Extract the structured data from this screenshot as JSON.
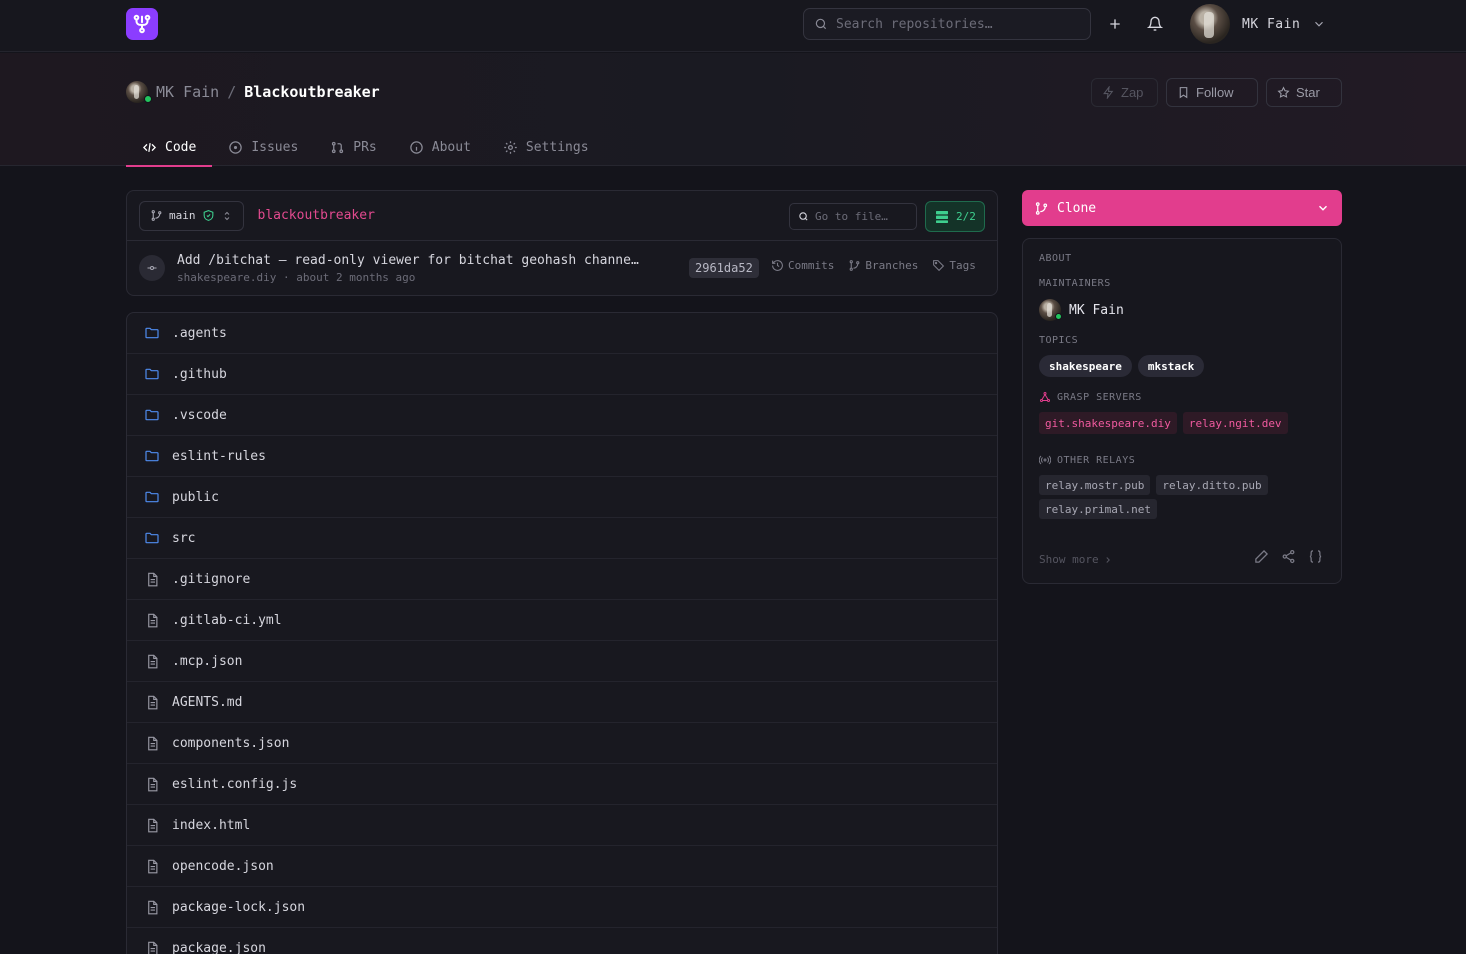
{
  "colors": {
    "accent": "#e23d8d",
    "logo": "#8b3dff",
    "online": "#22c55e",
    "relay_ok": "#3ecf8e"
  },
  "topbar": {
    "logo_icon": "fork-logo-icon",
    "search_placeholder": "Search repositories…",
    "add_icon": "plus-icon",
    "bell_icon": "bell-icon",
    "user_name": "MK Fain",
    "user_menu_icon": "chevron-down-icon"
  },
  "repo": {
    "owner": "MK Fain",
    "separator": "/",
    "name": "Blackoutbreaker",
    "actions": {
      "zap": "Zap",
      "follow": "Follow",
      "star": "Star"
    }
  },
  "tabs": [
    {
      "label": "Code",
      "icon": "code-icon",
      "active": true
    },
    {
      "label": "Issues",
      "icon": "circle-dot-icon",
      "active": false
    },
    {
      "label": "PRs",
      "icon": "pull-request-icon",
      "active": false
    },
    {
      "label": "About",
      "icon": "info-icon",
      "active": false
    },
    {
      "label": "Settings",
      "icon": "gear-icon",
      "active": false
    }
  ],
  "branch_bar": {
    "branch": "main",
    "repo_link": "blackoutbreaker",
    "goto_placeholder": "Go to file…",
    "relay_status": "2/2"
  },
  "commit": {
    "message": "Add /bitchat — read-only viewer for bitchat geohash channe…",
    "author": "shakespeare.diy",
    "dot": "·",
    "time": "about 2 months ago",
    "sha": "2961da52",
    "links": {
      "commits": "Commits",
      "branches": "Branches",
      "tags": "Tags"
    }
  },
  "files": [
    {
      "name": ".agents",
      "type": "folder"
    },
    {
      "name": ".github",
      "type": "folder"
    },
    {
      "name": ".vscode",
      "type": "folder"
    },
    {
      "name": "eslint-rules",
      "type": "folder"
    },
    {
      "name": "public",
      "type": "folder"
    },
    {
      "name": "src",
      "type": "folder"
    },
    {
      "name": ".gitignore",
      "type": "file"
    },
    {
      "name": ".gitlab-ci.yml",
      "type": "file"
    },
    {
      "name": ".mcp.json",
      "type": "file"
    },
    {
      "name": "AGENTS.md",
      "type": "file"
    },
    {
      "name": "components.json",
      "type": "file"
    },
    {
      "name": "eslint.config.js",
      "type": "file"
    },
    {
      "name": "index.html",
      "type": "file"
    },
    {
      "name": "opencode.json",
      "type": "file"
    },
    {
      "name": "package-lock.json",
      "type": "file"
    },
    {
      "name": "package.json",
      "type": "file"
    }
  ],
  "sidebar": {
    "clone_label": "Clone",
    "about_label": "ABOUT",
    "maintainers_label": "MAINTAINERS",
    "maintainer": "MK Fain",
    "topics_label": "TOPICS",
    "topics": [
      "shakespeare",
      "mkstack"
    ],
    "grasp_label": "GRASP SERVERS",
    "grasp_servers": [
      "git.shakespeare.diy",
      "relay.ngit.dev"
    ],
    "relays_label": "OTHER RELAYS",
    "relays": [
      "relay.mostr.pub",
      "relay.ditto.pub",
      "relay.primal.net"
    ],
    "show_more": "Show more",
    "action_icons": [
      "pencil-icon",
      "share-icon",
      "braces-icon"
    ]
  }
}
